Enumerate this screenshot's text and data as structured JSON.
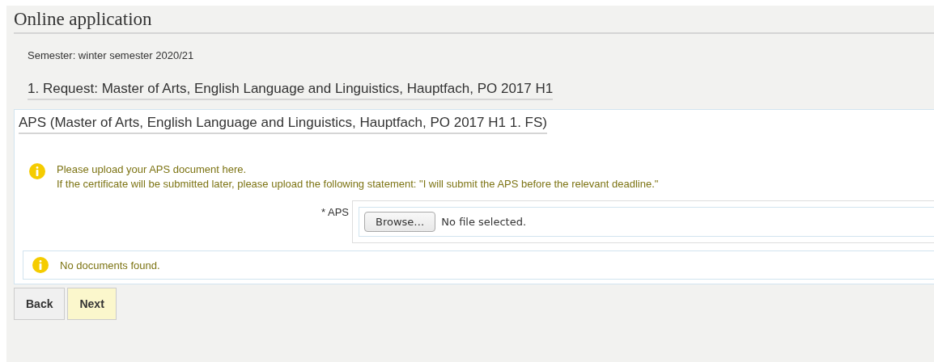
{
  "title": "Online application",
  "semester": "Semester: winter semester 2020/21",
  "request_heading": "1. Request: Master of Arts, English Language and Linguistics, Hauptfach, PO 2017 H1",
  "section": {
    "heading": "APS (Master of Arts, English Language and Linguistics, Hauptfach, PO 2017 H1 1. FS)",
    "info_lines": [
      "Please upload your APS document here.",
      "If the certificate will be submitted later, please upload the following statement: \"I will submit the APS before the relevant deadline.\""
    ],
    "upload": {
      "label": "* APS",
      "button": "Browse…",
      "status": "No file selected."
    },
    "documents_message": "No documents found."
  },
  "buttons": [
    {
      "label": "Back",
      "highlighted": false
    },
    {
      "label": "Next",
      "highlighted": true
    }
  ]
}
